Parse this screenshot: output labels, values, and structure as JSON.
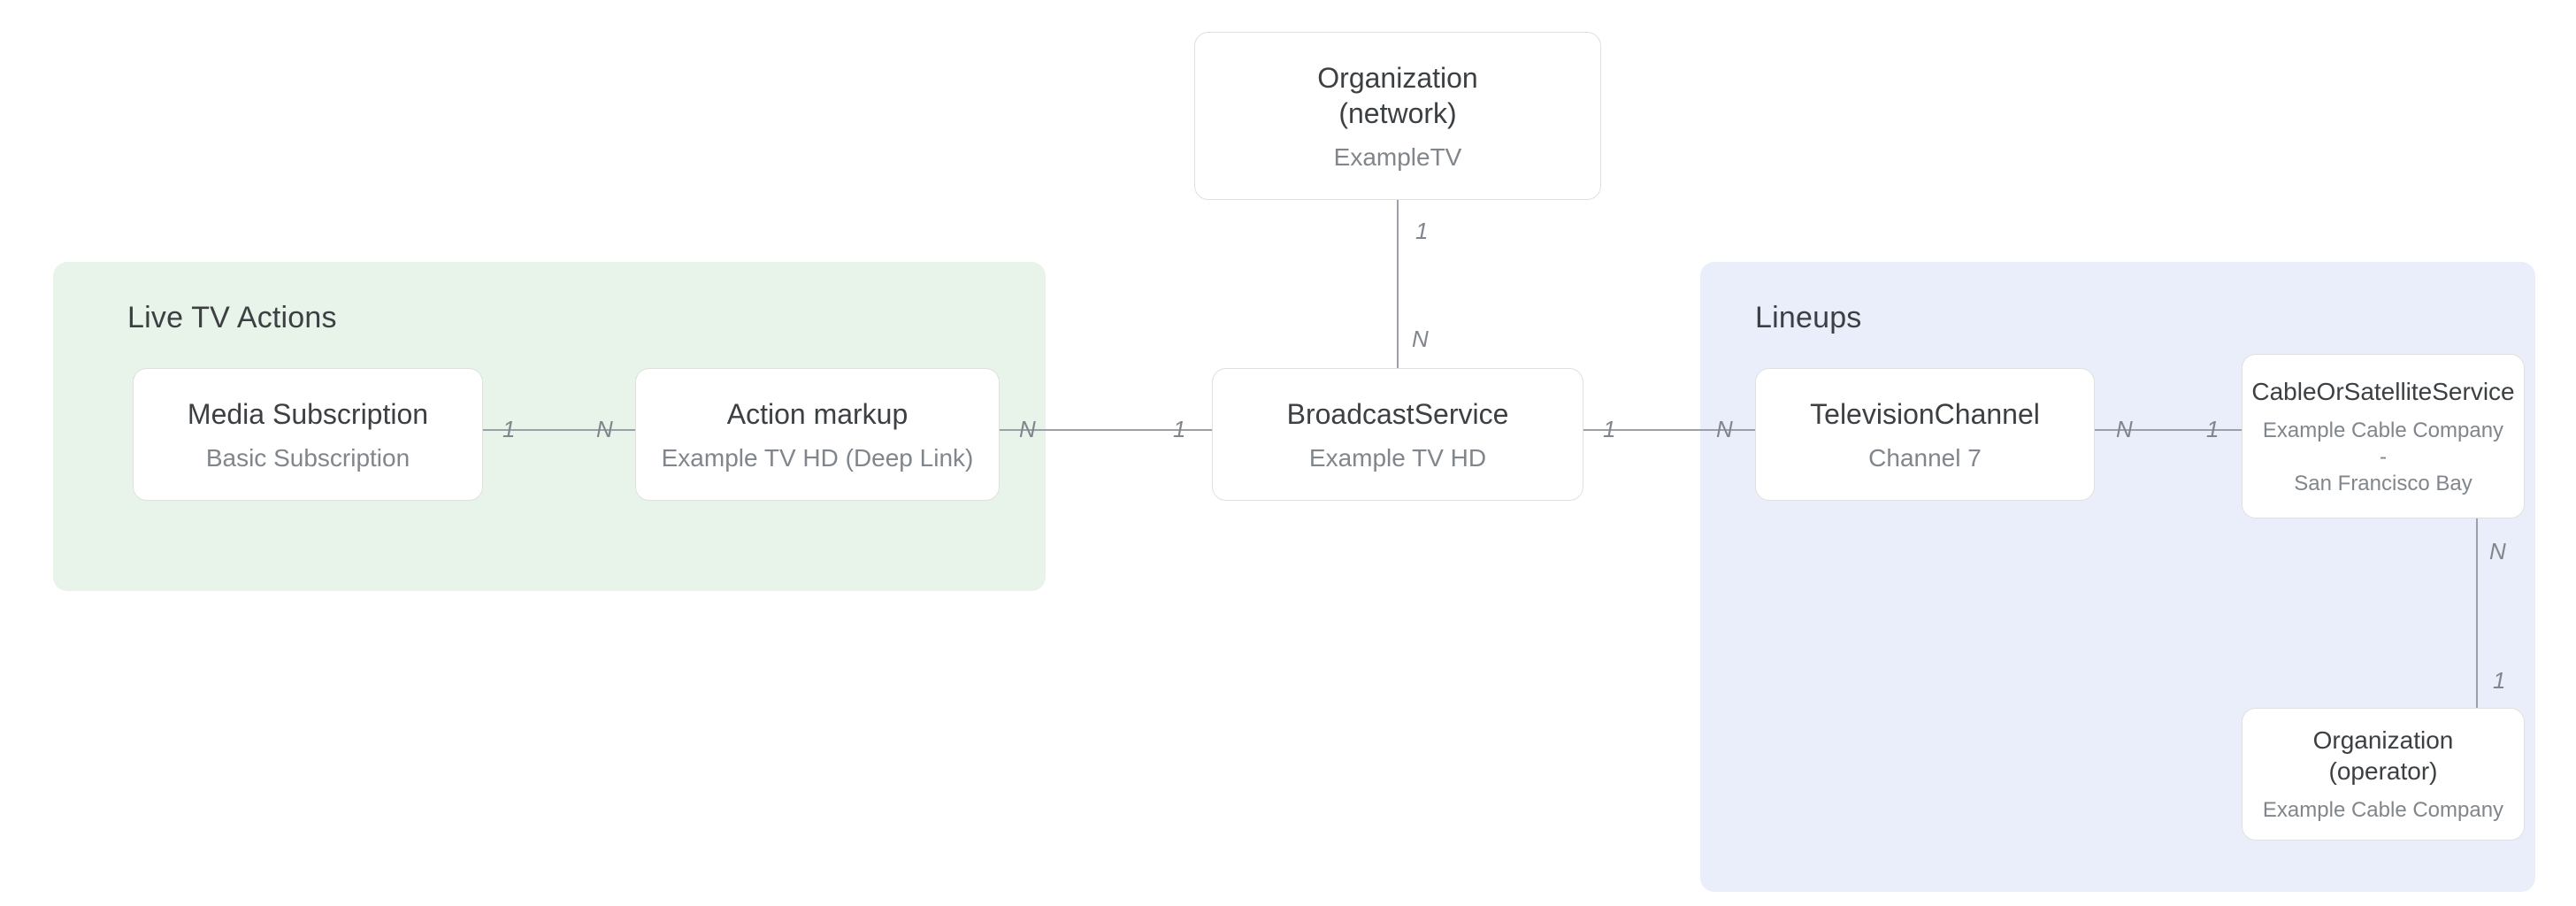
{
  "groups": {
    "liveTv": {
      "title": "Live TV Actions"
    },
    "lineups": {
      "title": "Lineups"
    }
  },
  "nodes": {
    "orgNetwork": {
      "title": "Organization\n(network)",
      "subtitle": "ExampleTV"
    },
    "mediaSub": {
      "title": "Media Subscription",
      "subtitle": "Basic Subscription"
    },
    "actionMarkup": {
      "title": "Action markup",
      "subtitle": "Example TV HD (Deep Link)"
    },
    "broadcast": {
      "title": "BroadcastService",
      "subtitle": "Example TV HD"
    },
    "tvChannel": {
      "title": "TelevisionChannel",
      "subtitle": "Channel 7"
    },
    "cableSat": {
      "title": "CableOrSatelliteService",
      "subtitle": "Example Cable Company -\nSan Francisco Bay"
    },
    "orgOperator": {
      "title": "Organization (operator)",
      "subtitle": "Example Cable Company"
    }
  },
  "cardinality": {
    "orgToBroadcast": {
      "top": "1",
      "bottom": "N"
    },
    "mediaToAction": {
      "left": "1",
      "right": "N"
    },
    "actionToBroadcast": {
      "left": "N",
      "right": "1"
    },
    "broadcastToTv": {
      "left": "1",
      "right": "N"
    },
    "tvToCable": {
      "left": "N",
      "right": "1"
    },
    "cableToOrg": {
      "top": "N",
      "bottom": "1"
    }
  }
}
